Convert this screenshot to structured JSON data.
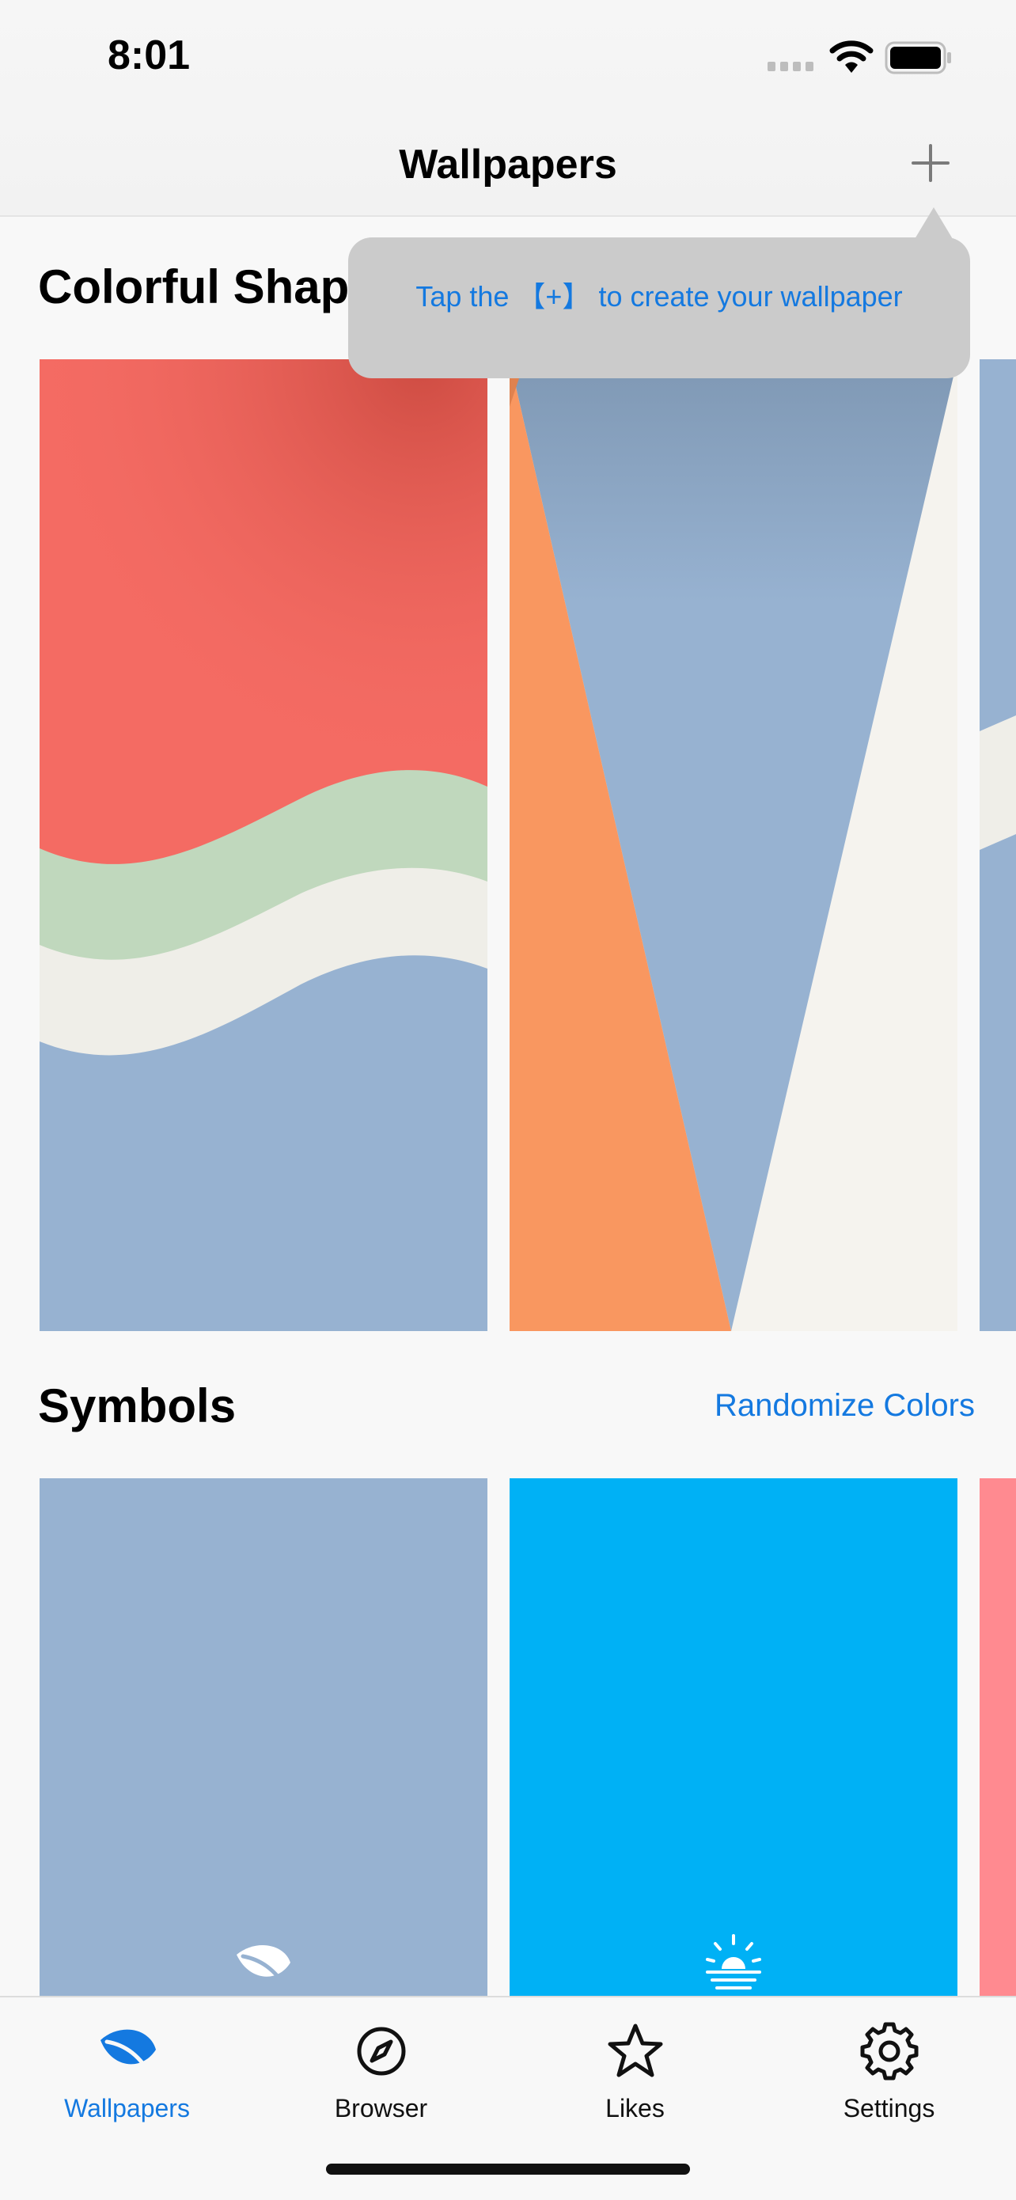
{
  "status_bar": {
    "time": "8:01"
  },
  "header": {
    "title": "Wallpapers",
    "add_icon": "plus-icon"
  },
  "tooltip": {
    "text": "Tap the 【+】 to create your wallpaper"
  },
  "sections": [
    {
      "title": "Colorful Shapes",
      "action": ""
    },
    {
      "title": "Symbols",
      "action": "Randomize Colors"
    }
  ],
  "colors": {
    "accent": "#1479e0",
    "card_red": "#f46b63",
    "card_blue": "#97b2d1",
    "card_green": "#c0d8bd",
    "card_cream": "#efeee8",
    "card_orange": "#f99760",
    "card_sky": "#00b1f5",
    "card_pink": "#ff8a90"
  },
  "symbol_icons": [
    "leaf-icon",
    "sunrise-icon"
  ],
  "tabs": [
    {
      "label": "Wallpapers",
      "icon": "leaf-icon",
      "active": true
    },
    {
      "label": "Browser",
      "icon": "compass-icon",
      "active": false
    },
    {
      "label": "Likes",
      "icon": "star-icon",
      "active": false
    },
    {
      "label": "Settings",
      "icon": "gear-icon",
      "active": false
    }
  ]
}
